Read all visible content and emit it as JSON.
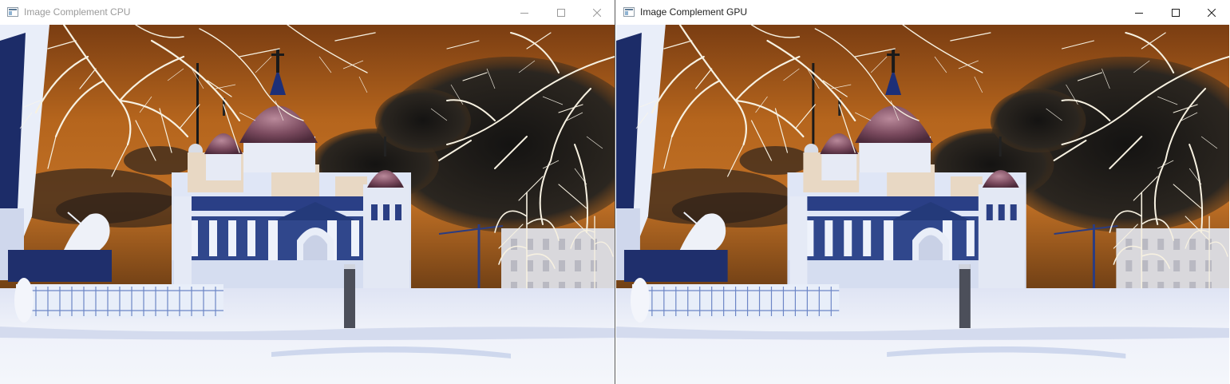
{
  "windows": [
    {
      "title": "Image Complement CPU",
      "controls": [
        "minimize-icon",
        "maximize-icon",
        "close-icon"
      ],
      "active": false
    },
    {
      "title": "Image Complement GPU",
      "controls": [
        "minimize-icon",
        "maximize-icon",
        "close-icon"
      ],
      "active": true
    }
  ],
  "colors": {
    "sky_top": "#7a3c10",
    "sky_mid": "#b8661c",
    "sky_horizon": "#5a3612",
    "dark_cloud": "#1e1d1c",
    "dome": "#7a4a5e",
    "building_blue": "#243a7a",
    "building_light": "#dfe6f6",
    "ground": "#eef1f9",
    "branches": "#f7f1e1"
  }
}
